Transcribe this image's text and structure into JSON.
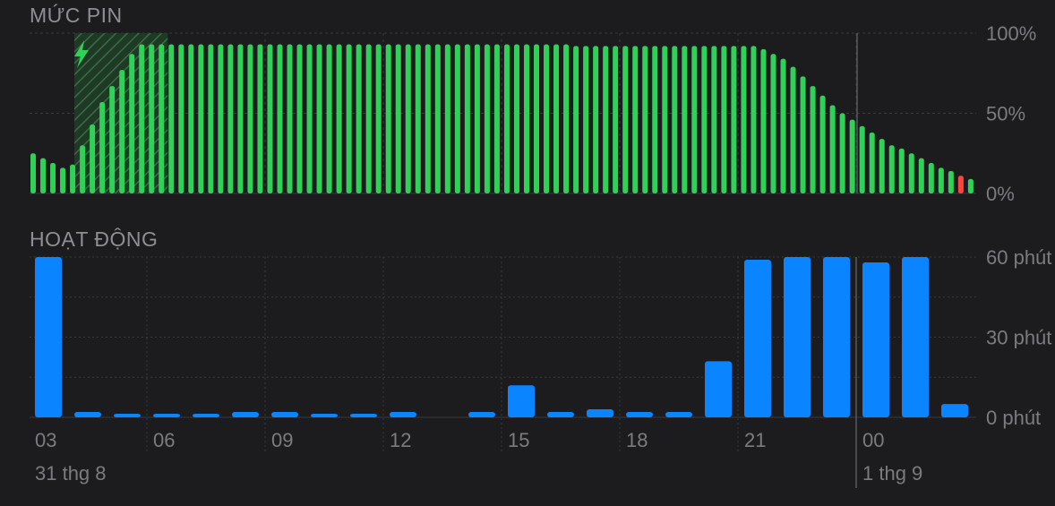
{
  "battery_section": {
    "title": "MỨC PIN"
  },
  "activity_section": {
    "title": "HOẠT ĐỘNG"
  },
  "colors": {
    "background": "#1c1c1e",
    "battery_green": "#30d158",
    "battery_low_red": "#ff453a",
    "activity_blue": "#0a84ff",
    "grid": "#3a3a3c",
    "label_gray": "#8e8e93"
  },
  "chart_data": [
    {
      "type": "bar",
      "name": "battery_level",
      "title": "MỨC PIN",
      "unit": "%",
      "ylim": [
        0,
        100
      ],
      "y_tick_labels": [
        "100%",
        "50%",
        "0%"
      ],
      "y_tick_values": [
        100,
        50,
        0
      ],
      "grid": true,
      "charging_period": {
        "start_index": 5,
        "end_index": 13
      },
      "charging_icon": "lightning-bolt-icon",
      "low_battery_index": 94,
      "values": [
        25,
        22,
        19,
        16,
        18,
        30,
        43,
        57,
        67,
        77,
        87,
        93,
        93,
        93,
        93,
        93,
        93,
        93,
        93,
        93,
        93,
        93,
        93,
        93,
        93,
        93,
        93,
        93,
        93,
        93,
        93,
        93,
        93,
        93,
        93,
        93,
        93,
        93,
        93,
        93,
        93,
        93,
        93,
        93,
        93,
        93,
        93,
        93,
        93,
        93,
        93,
        93,
        93,
        93,
        93,
        92,
        92,
        92,
        92,
        92,
        92,
        92,
        92,
        92,
        92,
        92,
        92,
        92,
        92,
        92,
        92,
        92,
        92,
        92,
        90,
        87,
        84,
        79,
        73,
        67,
        61,
        55,
        50,
        46,
        42,
        38,
        34,
        30,
        28,
        25,
        22,
        19,
        16,
        14,
        11,
        9
      ]
    },
    {
      "type": "bar",
      "name": "activity",
      "title": "HOẠT ĐỘNG",
      "unit": "phút",
      "ylim": [
        0,
        60
      ],
      "y_tick_labels": [
        "60 phút",
        "30 phút",
        "0 phút"
      ],
      "y_tick_values": [
        60,
        30,
        0
      ],
      "grid": true,
      "hours": [
        "03",
        "04",
        "05",
        "06",
        "07",
        "08",
        "09",
        "10",
        "11",
        "12",
        "13",
        "14",
        "15",
        "16",
        "17",
        "18",
        "19",
        "20",
        "21",
        "22",
        "23",
        "00",
        "01",
        "02"
      ],
      "values": [
        60,
        2,
        1,
        1,
        1,
        2,
        2,
        1,
        1,
        2,
        0,
        2,
        12,
        2,
        3,
        2,
        2,
        21,
        59,
        60,
        60,
        58,
        60,
        5
      ],
      "x_tick_labels": [
        {
          "label": "03",
          "hour_index": 0
        },
        {
          "label": "06",
          "hour_index": 3
        },
        {
          "label": "09",
          "hour_index": 6
        },
        {
          "label": "12",
          "hour_index": 9
        },
        {
          "label": "15",
          "hour_index": 12
        },
        {
          "label": "18",
          "hour_index": 15
        },
        {
          "label": "21",
          "hour_index": 18
        },
        {
          "label": "00",
          "hour_index": 21
        }
      ],
      "date_labels": [
        {
          "label": "31 thg 8",
          "hour_index": 0
        },
        {
          "label": "1 thg 9",
          "hour_index": 21
        }
      ]
    }
  ]
}
